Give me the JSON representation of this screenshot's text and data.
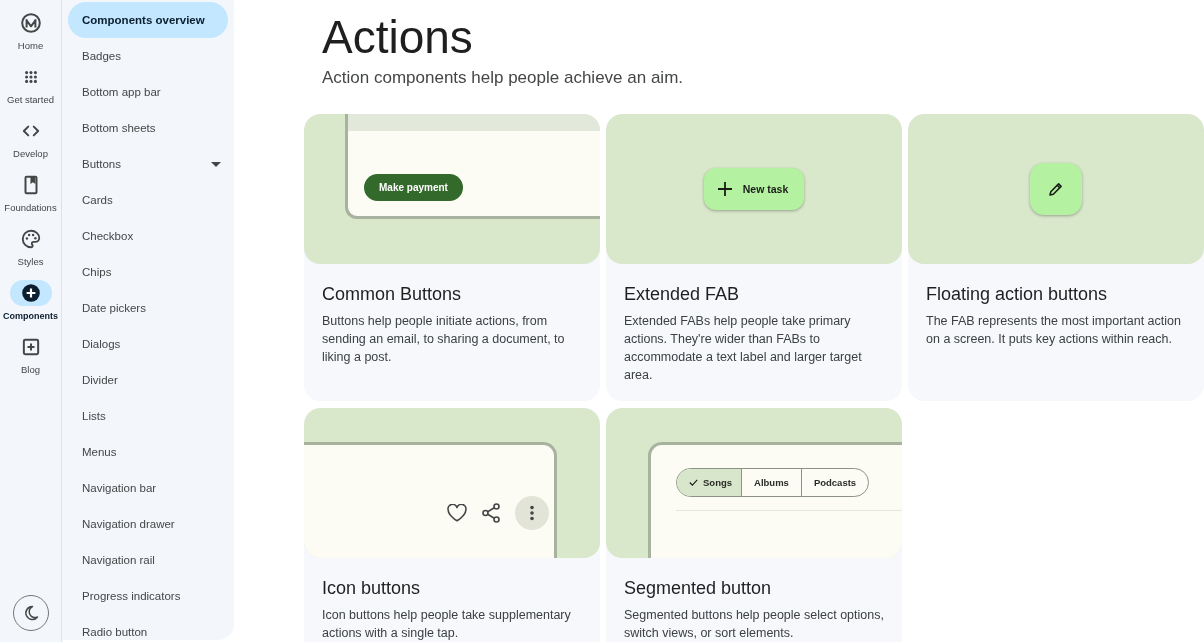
{
  "rail": {
    "items": [
      {
        "label": "Home",
        "selected": false
      },
      {
        "label": "Get started",
        "selected": false
      },
      {
        "label": "Develop",
        "selected": false
      },
      {
        "label": "Foundations",
        "selected": false
      },
      {
        "label": "Styles",
        "selected": false
      },
      {
        "label": "Components",
        "selected": true
      },
      {
        "label": "Blog",
        "selected": false
      }
    ]
  },
  "nav": {
    "items": [
      {
        "label": "Components overview",
        "kind": "link",
        "selected": true
      },
      {
        "label": "Badges",
        "kind": "link",
        "selected": false
      },
      {
        "label": "Bottom app bar",
        "kind": "link",
        "selected": false
      },
      {
        "label": "Bottom sheets",
        "kind": "link",
        "selected": false
      },
      {
        "label": "Buttons",
        "kind": "group",
        "selected": false
      },
      {
        "label": "Cards",
        "kind": "link",
        "selected": false
      },
      {
        "label": "Checkbox",
        "kind": "link",
        "selected": false
      },
      {
        "label": "Chips",
        "kind": "link",
        "selected": false
      },
      {
        "label": "Date pickers",
        "kind": "link",
        "selected": false
      },
      {
        "label": "Dialogs",
        "kind": "link",
        "selected": false
      },
      {
        "label": "Divider",
        "kind": "link",
        "selected": false
      },
      {
        "label": "Lists",
        "kind": "link",
        "selected": false
      },
      {
        "label": "Menus",
        "kind": "link",
        "selected": false
      },
      {
        "label": "Navigation bar",
        "kind": "link",
        "selected": false
      },
      {
        "label": "Navigation drawer",
        "kind": "link",
        "selected": false
      },
      {
        "label": "Navigation rail",
        "kind": "link",
        "selected": false
      },
      {
        "label": "Progress indicators",
        "kind": "link",
        "selected": false
      },
      {
        "label": "Radio button",
        "kind": "link",
        "selected": false
      }
    ]
  },
  "page": {
    "title": "Actions",
    "subtitle": "Action components help people achieve an aim."
  },
  "cards": [
    {
      "kind": "common_buttons",
      "title": "Common Buttons",
      "description": "Buttons help people initiate actions, from sending an email, to sharing a document, to liking a post.",
      "preview": {
        "button": "Make payment"
      }
    },
    {
      "kind": "extended_fab",
      "title": "Extended FAB",
      "description": "Extended FABs help people take primary actions. They're wider than FABs to accommodate a text label and larger target area.",
      "preview": {
        "label": "New task"
      }
    },
    {
      "kind": "fab",
      "title": "Floating action buttons",
      "description": "The FAB represents the most important action on a screen. It puts key actions within reach."
    },
    {
      "kind": "icon_buttons",
      "title": "Icon buttons",
      "description": "Icon buttons help people take supplementary actions with a single tap."
    },
    {
      "kind": "segmented",
      "title": "Segmented button",
      "description": "Segmented buttons help people select options, switch views, or sort elements.",
      "preview": {
        "segments": [
          {
            "label": "Songs",
            "selected": true
          },
          {
            "label": "Albums",
            "selected": false
          },
          {
            "label": "Podcasts",
            "selected": false
          }
        ]
      }
    }
  ]
}
